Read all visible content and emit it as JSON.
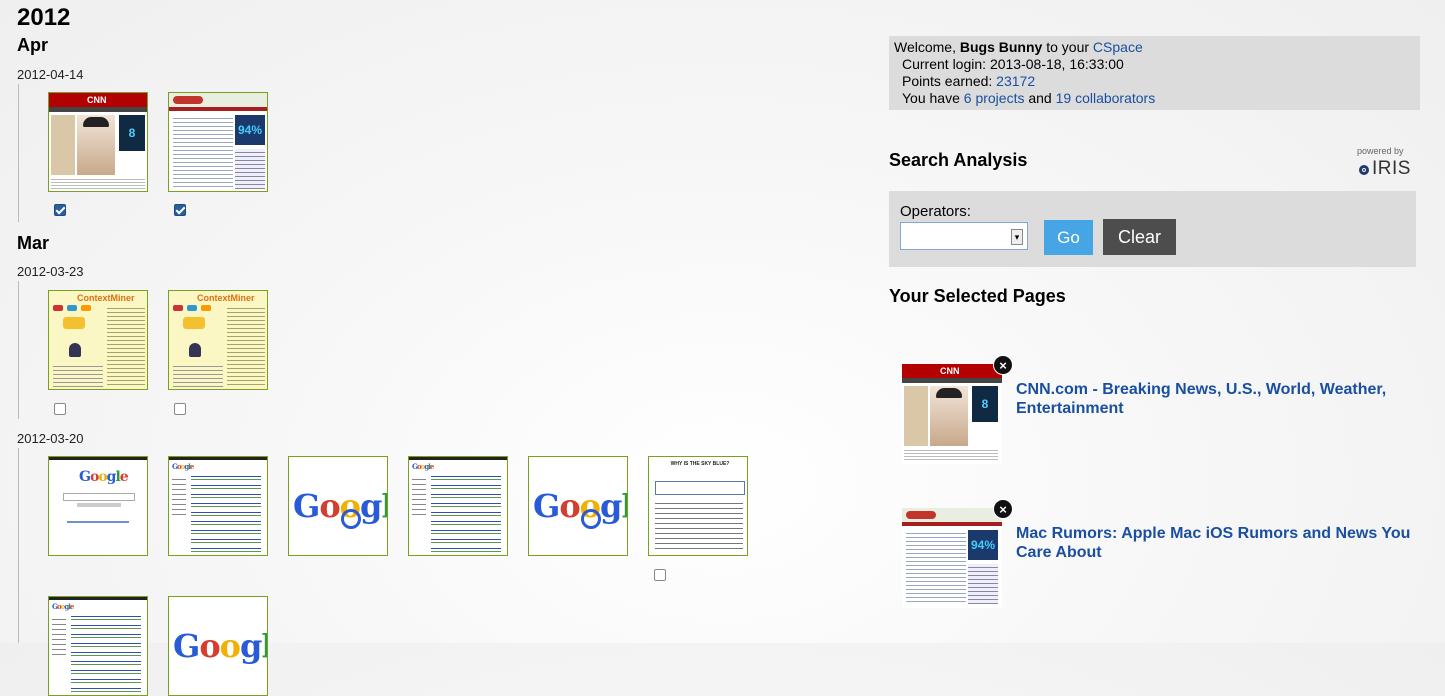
{
  "timeline": {
    "year": "2012",
    "months": [
      {
        "label": "Apr",
        "dates": [
          {
            "label": "2012-04-14",
            "items": [
              {
                "kind": "cnn",
                "checked": true
              },
              {
                "kind": "macrumors",
                "checked": true
              }
            ]
          }
        ]
      },
      {
        "label": "Mar",
        "dates": [
          {
            "label": "2012-03-23",
            "items": [
              {
                "kind": "contextminer",
                "title": "ContextMiner",
                "checked": false
              },
              {
                "kind": "contextminer",
                "title": "ContextMiner",
                "checked": false
              }
            ]
          },
          {
            "label": "2012-03-20",
            "items": [
              {
                "kind": "google-home"
              },
              {
                "kind": "google-results"
              },
              {
                "kind": "google-logo"
              },
              {
                "kind": "google-results"
              },
              {
                "kind": "google-logo"
              },
              {
                "kind": "why-sky-blue",
                "title": "WHY IS THE SKY BLUE?",
                "checked": false
              },
              {
                "kind": "google-results"
              },
              {
                "kind": "google-logo"
              }
            ]
          }
        ]
      }
    ]
  },
  "welcome": {
    "prefix": "Welcome, ",
    "user": "Bugs Bunny",
    "middle": " to your ",
    "space_link": "CSpace",
    "current_login_label": "Current login: ",
    "current_login_value": "2013-08-18, 16:33:00",
    "points_label": "Points earned: ",
    "points_value": "23172",
    "have_label": "You have ",
    "projects_link": "6 projects",
    "and_label": " and ",
    "collaborators_link": "19 collaborators"
  },
  "search_analysis": {
    "heading": "Search Analysis",
    "powered_by": "powered by",
    "brand": "IRIS",
    "operators_label": "Operators:",
    "operators_value": "",
    "go_label": "Go",
    "clear_label": "Clear"
  },
  "selected_pages": {
    "heading": "Your Selected Pages",
    "items": [
      {
        "kind": "cnn",
        "title": "CNN.com - Breaking News, U.S., World, Weather, Entertainment"
      },
      {
        "kind": "macrumors",
        "title": "Mac Rumors: Apple Mac iOS Rumors and News You Care About"
      }
    ]
  },
  "thumb_text": {
    "cnn_logo": "CNN",
    "cnn_ad": "8",
    "mac_big": "94%",
    "google": [
      "G",
      "o",
      "o",
      "g",
      "l",
      "e"
    ],
    "close_glyph": "×"
  },
  "colors": {
    "link": "#1a4fa0",
    "thumb_border": "#7aa020",
    "go_button": "#46a6e5",
    "clear_button": "#4d4d4d",
    "panel_bg": "#dcdcdc"
  }
}
